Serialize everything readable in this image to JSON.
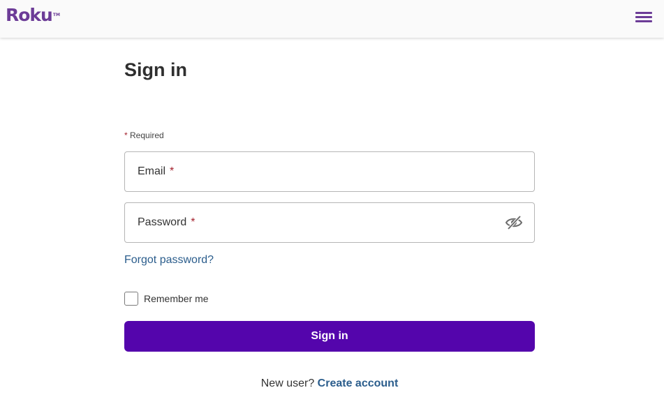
{
  "colors": {
    "brand": "#6c3c97",
    "primary_button": "#5405ac",
    "link": "#2b5d8c",
    "required_star": "#a4222e"
  },
  "header": {
    "logo_text": "Roku",
    "logo_tm": "TM",
    "menu_icon": "hamburger-menu-icon"
  },
  "page": {
    "title": "Sign in",
    "required_star": "*",
    "required_note": "Required"
  },
  "form": {
    "email": {
      "label": "Email",
      "star": "*",
      "value": ""
    },
    "password": {
      "label": "Password",
      "star": "*",
      "value": "",
      "toggle_icon": "eye-slash-icon"
    },
    "forgot_link": "Forgot password?",
    "remember_label": "Remember me",
    "remember_checked": false,
    "submit_label": "Sign in"
  },
  "footer": {
    "prompt": "New user?",
    "create_link": "Create account"
  }
}
